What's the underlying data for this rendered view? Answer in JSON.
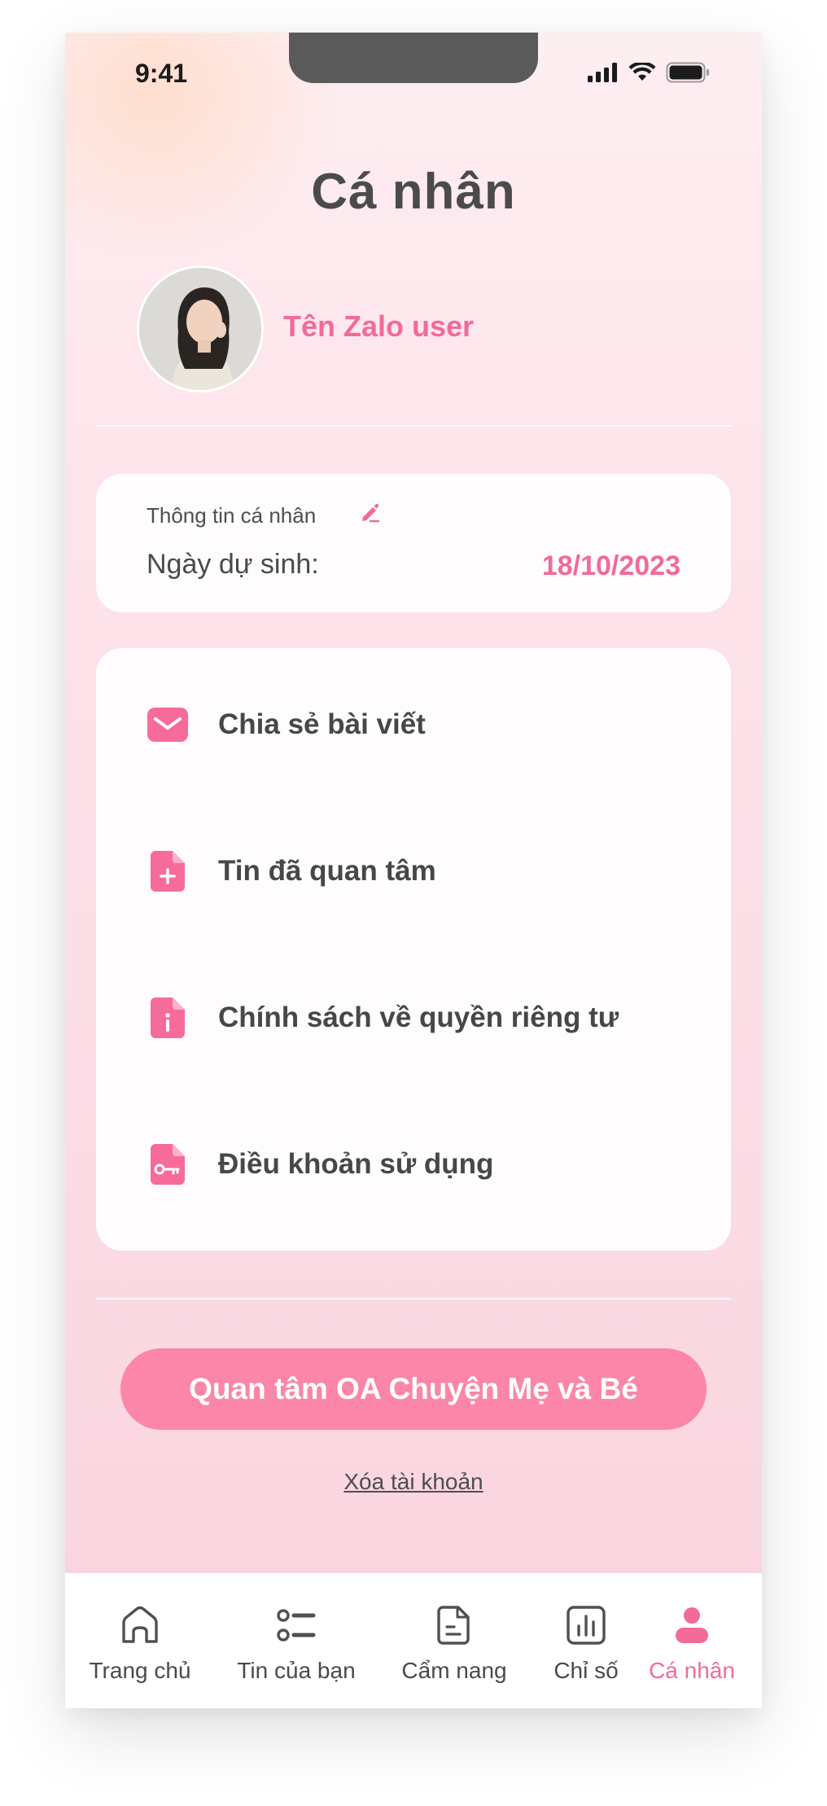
{
  "status_bar": {
    "time": "9:41"
  },
  "page": {
    "title": "Cá nhân"
  },
  "profile": {
    "name": "Tên Zalo user"
  },
  "personal_info": {
    "label": "Thông tin cá nhân",
    "due_date_label": "Ngày dự sinh:",
    "due_date_value": "18/10/2023"
  },
  "menu": {
    "items": [
      {
        "label": "Chia sẻ bài viết",
        "icon": "mail-icon"
      },
      {
        "label": "Tin đã quan tâm",
        "icon": "document-plus-icon"
      },
      {
        "label": "Chính sách về quyền riêng tư",
        "icon": "document-info-icon"
      },
      {
        "label": "Điều khoản sử dụng",
        "icon": "document-key-icon"
      }
    ]
  },
  "actions": {
    "follow_oa_label": "Quan tâm OA Chuyện Mẹ và Bé",
    "delete_account_label": "Xóa tài khoản"
  },
  "bottom_nav": {
    "items": [
      {
        "label": "Trang chủ",
        "icon": "home-icon"
      },
      {
        "label": "Tin của bạn",
        "icon": "list-icon"
      },
      {
        "label": "Cẩm nang",
        "icon": "handbook-icon"
      },
      {
        "label": "Chỉ số",
        "icon": "chart-icon"
      },
      {
        "label": "Cá nhân",
        "icon": "user-icon",
        "active": true
      }
    ]
  },
  "colors": {
    "accent": "#f26a99",
    "button": "#fb86a9",
    "text": "#4a4a4a"
  }
}
